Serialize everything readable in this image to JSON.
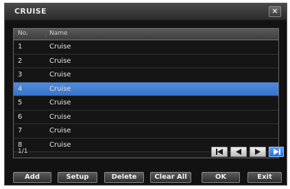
{
  "window": {
    "title": "CRUISE",
    "close_label": "✕"
  },
  "table": {
    "headers": {
      "no": "No.",
      "name": "Name"
    },
    "rows": [
      {
        "no": "1",
        "name": "Cruise",
        "selected": false
      },
      {
        "no": "2",
        "name": "Cruise",
        "selected": false
      },
      {
        "no": "3",
        "name": "Cruise",
        "selected": false
      },
      {
        "no": "4",
        "name": "Cruise",
        "selected": true
      },
      {
        "no": "5",
        "name": "Cruise",
        "selected": false
      },
      {
        "no": "6",
        "name": "Cruise",
        "selected": false
      },
      {
        "no": "7",
        "name": "Cruise",
        "selected": false
      },
      {
        "no": "8",
        "name": "Cruise",
        "selected": false
      }
    ],
    "page_indicator": "1/1"
  },
  "pager": {
    "icons": [
      "first-page-icon",
      "previous-page-icon",
      "next-page-icon",
      "last-page-icon"
    ]
  },
  "buttons": {
    "add": "Add",
    "setup": "Setup",
    "delete": "Delete",
    "clear_all": "Clear All",
    "ok": "OK",
    "exit": "Exit"
  },
  "colors": {
    "selection": "#3f7dd6",
    "window_bg": "#121212",
    "active_pager": "#2a6fd8"
  }
}
